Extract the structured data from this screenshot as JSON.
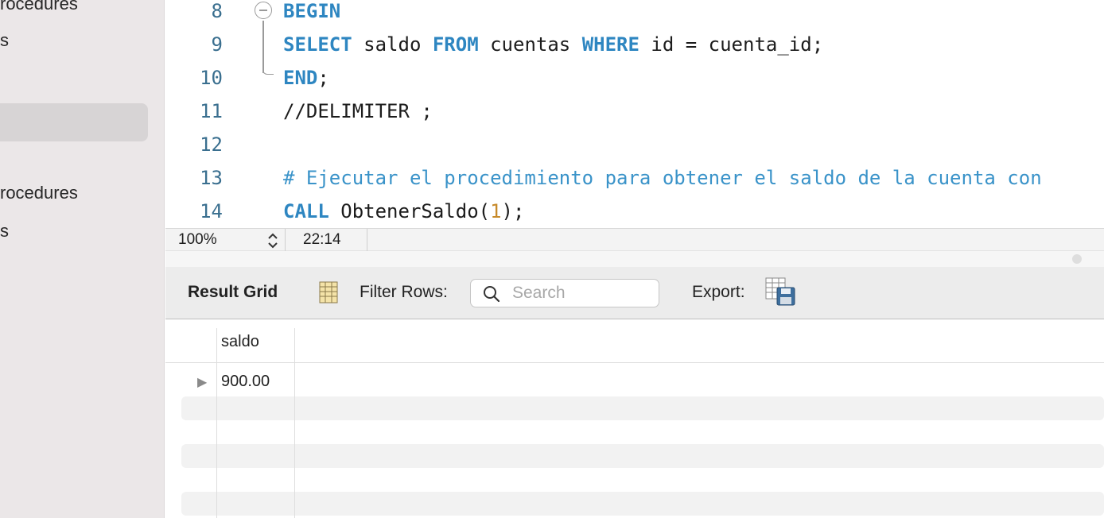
{
  "sidebar": {
    "items": [
      {
        "label": "rocedures"
      },
      {
        "label": "s"
      },
      {
        "label": "rocedures"
      },
      {
        "label": "s"
      }
    ]
  },
  "editor": {
    "lines": [
      {
        "number": "8",
        "tokens": [
          {
            "t": "BEGIN",
            "c": "kw"
          }
        ]
      },
      {
        "number": "9",
        "tokens": [
          {
            "t": "SELECT",
            "c": "kw"
          },
          {
            "t": " saldo ",
            "c": ""
          },
          {
            "t": "FROM",
            "c": "kw"
          },
          {
            "t": " cuentas ",
            "c": ""
          },
          {
            "t": "WHERE",
            "c": "kw"
          },
          {
            "t": " id = cuenta_id;",
            "c": ""
          }
        ]
      },
      {
        "number": "10",
        "tokens": [
          {
            "t": "END",
            "c": "kw"
          },
          {
            "t": ";",
            "c": ""
          }
        ]
      },
      {
        "number": "11",
        "tokens": [
          {
            "t": "//DELIMITER ;",
            "c": ""
          }
        ]
      },
      {
        "number": "12",
        "tokens": []
      },
      {
        "number": "13",
        "tokens": [
          {
            "t": "# Ejecutar el procedimiento para obtener el saldo de la cuenta con",
            "c": "cmt"
          }
        ]
      },
      {
        "number": "14",
        "tokens": [
          {
            "t": "CALL",
            "c": "kw"
          },
          {
            "t": " ObtenerSaldo(",
            "c": ""
          },
          {
            "t": "1",
            "c": "num"
          },
          {
            "t": ");",
            "c": ""
          }
        ]
      }
    ]
  },
  "statusbar": {
    "zoom": "100%",
    "cursor_position": "22:14"
  },
  "results": {
    "result_grid_label": "Result Grid",
    "filter_label": "Filter Rows:",
    "search_placeholder": "Search",
    "export_label": "Export:",
    "columns": [
      "saldo"
    ],
    "rows": [
      [
        "900.00"
      ]
    ]
  }
}
